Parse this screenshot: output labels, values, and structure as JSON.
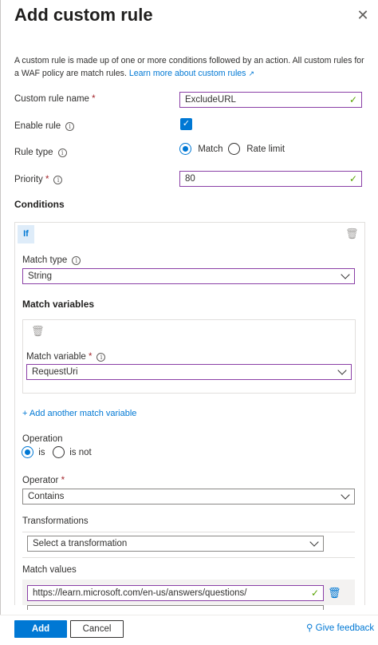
{
  "panel": {
    "title": "Add custom rule",
    "description": "A custom rule is made up of one or more conditions followed by an action. All custom rules for a WAF policy are match rules.",
    "learn_more": "Learn more about custom rules"
  },
  "form": {
    "rule_name_label": "Custom rule name",
    "rule_name_value": "ExcludeURL",
    "enable_label": "Enable rule",
    "rule_type_label": "Rule type",
    "rule_type_options": [
      "Match",
      "Rate limit"
    ],
    "rule_type_selected": "Match",
    "priority_label": "Priority",
    "priority_value": "80",
    "required_mark": "*"
  },
  "conditions": {
    "heading": "Conditions",
    "if_label": "If",
    "match_type_label": "Match type",
    "match_type_value": "String",
    "match_variables_heading": "Match variables",
    "match_variable_label": "Match variable",
    "match_variable_value": "RequestUri",
    "add_variable_link": "+ Add another match variable",
    "operation_label": "Operation",
    "operation_options": [
      "is",
      "is not"
    ],
    "operation_selected": "is",
    "operator_label": "Operator",
    "operator_value": "Contains",
    "transformations_label": "Transformations",
    "transformations_placeholder": "Select a transformation",
    "match_values_label": "Match values",
    "match_value": "https://learn.microsoft.com/en-us/answers/questions/"
  },
  "footer": {
    "add_label": "Add",
    "cancel_label": "Cancel",
    "feedback_label": "Give feedback"
  }
}
